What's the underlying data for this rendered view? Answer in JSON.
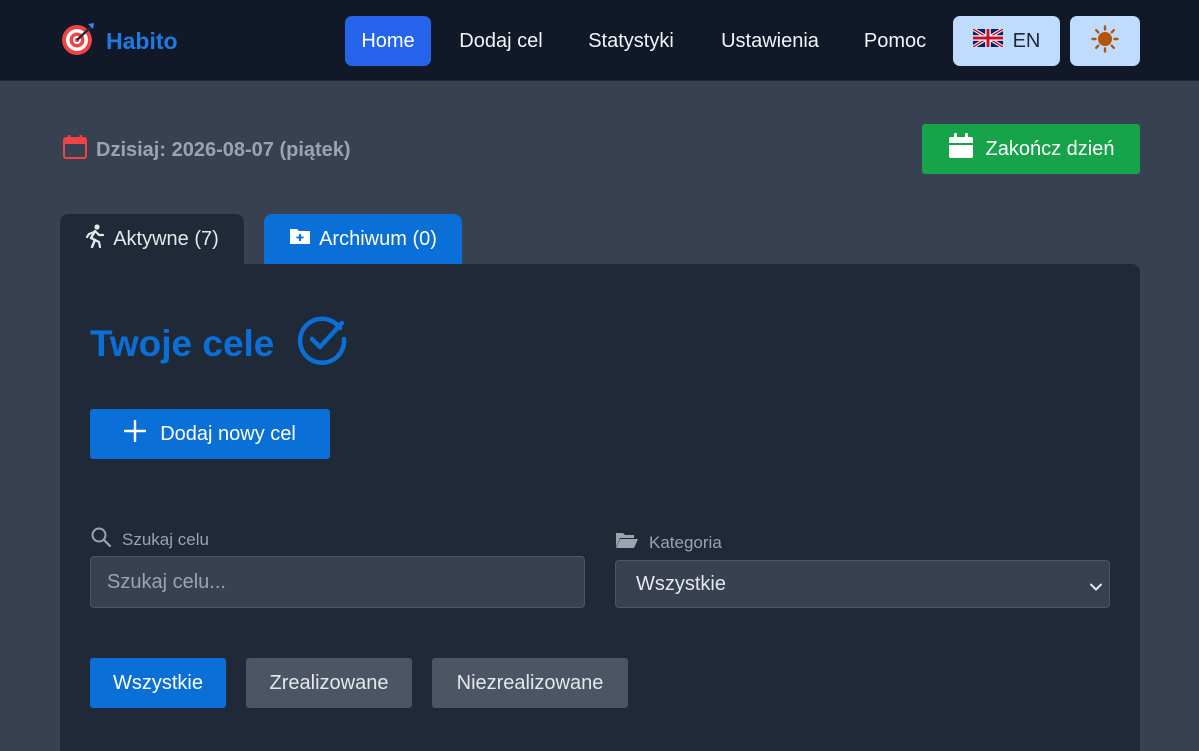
{
  "brand": {
    "name": "Habito",
    "icon": "target-icon"
  },
  "nav": {
    "items": [
      {
        "label": "Home",
        "active": true
      },
      {
        "label": "Dodaj cel",
        "active": false
      },
      {
        "label": "Statystyki",
        "active": false
      },
      {
        "label": "Ustawienia",
        "active": false
      },
      {
        "label": "Pomoc",
        "active": false
      }
    ],
    "language": {
      "label": "EN",
      "icon": "uk-flag-icon"
    },
    "theme": {
      "icon": "sun-icon"
    }
  },
  "header": {
    "date_text": "Dzisiaj: 2026-08-07 (piątek)",
    "end_day_label": "Zakończ dzień"
  },
  "tabs": [
    {
      "label": "Aktywne (7)",
      "icon": "running-person-icon",
      "active": true
    },
    {
      "label": "Archiwum (0)",
      "icon": "folder-plus-icon",
      "active": false
    }
  ],
  "main": {
    "title": "Twoje cele",
    "add_goal_label": "Dodaj nowy cel",
    "search": {
      "label": "Szukaj celu",
      "placeholder": "Szukaj celu...",
      "value": ""
    },
    "category": {
      "label": "Kategoria",
      "selected": "Wszystkie"
    },
    "filters": [
      "Wszystkie",
      "Zrealizowane",
      "Niezrealizowane"
    ]
  },
  "colors": {
    "primary": "#0b6fd8",
    "nav_active": "#2563eb",
    "success": "#16a34a",
    "navbar_bg": "#111827",
    "card_bg": "#1f2937",
    "page_bg": "#374151"
  }
}
